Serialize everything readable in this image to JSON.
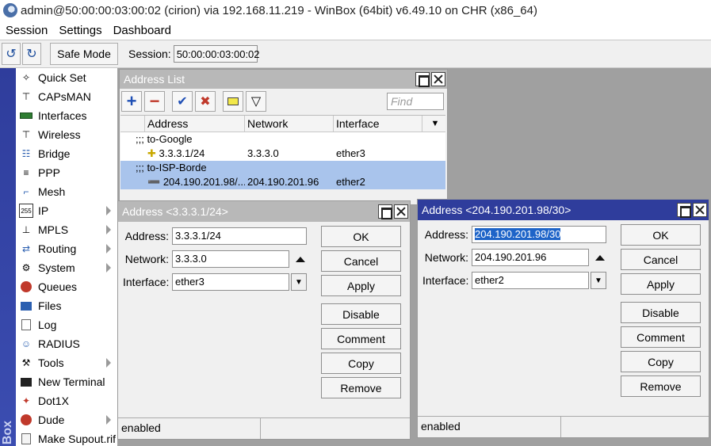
{
  "titlebar": {
    "title": "admin@50:00:00:03:00:02 (cirion) via 192.168.11.219 - WinBox (64bit) v6.49.10 on CHR (x86_64)"
  },
  "menu": [
    "Session",
    "Settings",
    "Dashboard"
  ],
  "toolbar": {
    "safe_mode": "Safe Mode",
    "session_label": "Session:",
    "session_value": "50:00:00:03:00:02"
  },
  "vstrip_text": "Box",
  "sidebar": [
    {
      "label": "Quick Set",
      "icon": "wand-icon",
      "sub": false
    },
    {
      "label": "CAPsMAN",
      "icon": "antenna-icon",
      "sub": false
    },
    {
      "label": "Interfaces",
      "icon": "interfaces-icon",
      "sub": false
    },
    {
      "label": "Wireless",
      "icon": "antenna-icon",
      "sub": false
    },
    {
      "label": "Bridge",
      "icon": "bridge-icon",
      "sub": false
    },
    {
      "label": "PPP",
      "icon": "ppp-icon",
      "sub": false
    },
    {
      "label": "Mesh",
      "icon": "mesh-icon",
      "sub": false
    },
    {
      "label": "IP",
      "icon": "ip-icon",
      "sub": true
    },
    {
      "label": "MPLS",
      "icon": "mpls-icon",
      "sub": true
    },
    {
      "label": "Routing",
      "icon": "routing-icon",
      "sub": true
    },
    {
      "label": "System",
      "icon": "gear-icon",
      "sub": true
    },
    {
      "label": "Queues",
      "icon": "queues-icon",
      "sub": false
    },
    {
      "label": "Files",
      "icon": "folder-icon",
      "sub": false
    },
    {
      "label": "Log",
      "icon": "log-icon",
      "sub": false
    },
    {
      "label": "RADIUS",
      "icon": "radius-icon",
      "sub": false
    },
    {
      "label": "Tools",
      "icon": "tools-icon",
      "sub": true
    },
    {
      "label": "New Terminal",
      "icon": "terminal-icon",
      "sub": false
    },
    {
      "label": "Dot1X",
      "icon": "dot1x-icon",
      "sub": false
    },
    {
      "label": "Dude",
      "icon": "dude-icon",
      "sub": true
    },
    {
      "label": "Make Supout.rif",
      "icon": "document-icon",
      "sub": false
    }
  ],
  "address_list": {
    "title": "Address List",
    "find_placeholder": "Find",
    "columns": [
      "Address",
      "Network",
      "Interface"
    ],
    "rows": [
      {
        "type": "comment",
        "text": ";;; to-Google",
        "selected": false
      },
      {
        "type": "entry",
        "address": "3.3.3.1/24",
        "network": "3.3.3.0",
        "interface": "ether3",
        "selected": false
      },
      {
        "type": "comment",
        "text": ";;; to-ISP-Borde",
        "selected": true
      },
      {
        "type": "entry",
        "address": "204.190.201.98/...",
        "network": "204.190.201.96",
        "interface": "ether2",
        "selected": true
      }
    ]
  },
  "dialog1": {
    "title": "Address <3.3.3.1/24>",
    "address_label": "Address:",
    "address": "3.3.3.1/24",
    "network_label": "Network:",
    "network": "3.3.3.0",
    "interface_label": "Interface:",
    "interface": "ether3",
    "buttons": [
      "OK",
      "Cancel",
      "Apply",
      "Disable",
      "Comment",
      "Copy",
      "Remove"
    ],
    "status": "enabled"
  },
  "dialog2": {
    "title": "Address <204.190.201.98/30>",
    "address_label": "Address:",
    "address": "204.190.201.98/30",
    "network_label": "Network:",
    "network": "204.190.201.96",
    "interface_label": "Interface:",
    "interface": "ether2",
    "buttons": [
      "OK",
      "Cancel",
      "Apply",
      "Disable",
      "Comment",
      "Copy",
      "Remove"
    ],
    "status": "enabled"
  }
}
